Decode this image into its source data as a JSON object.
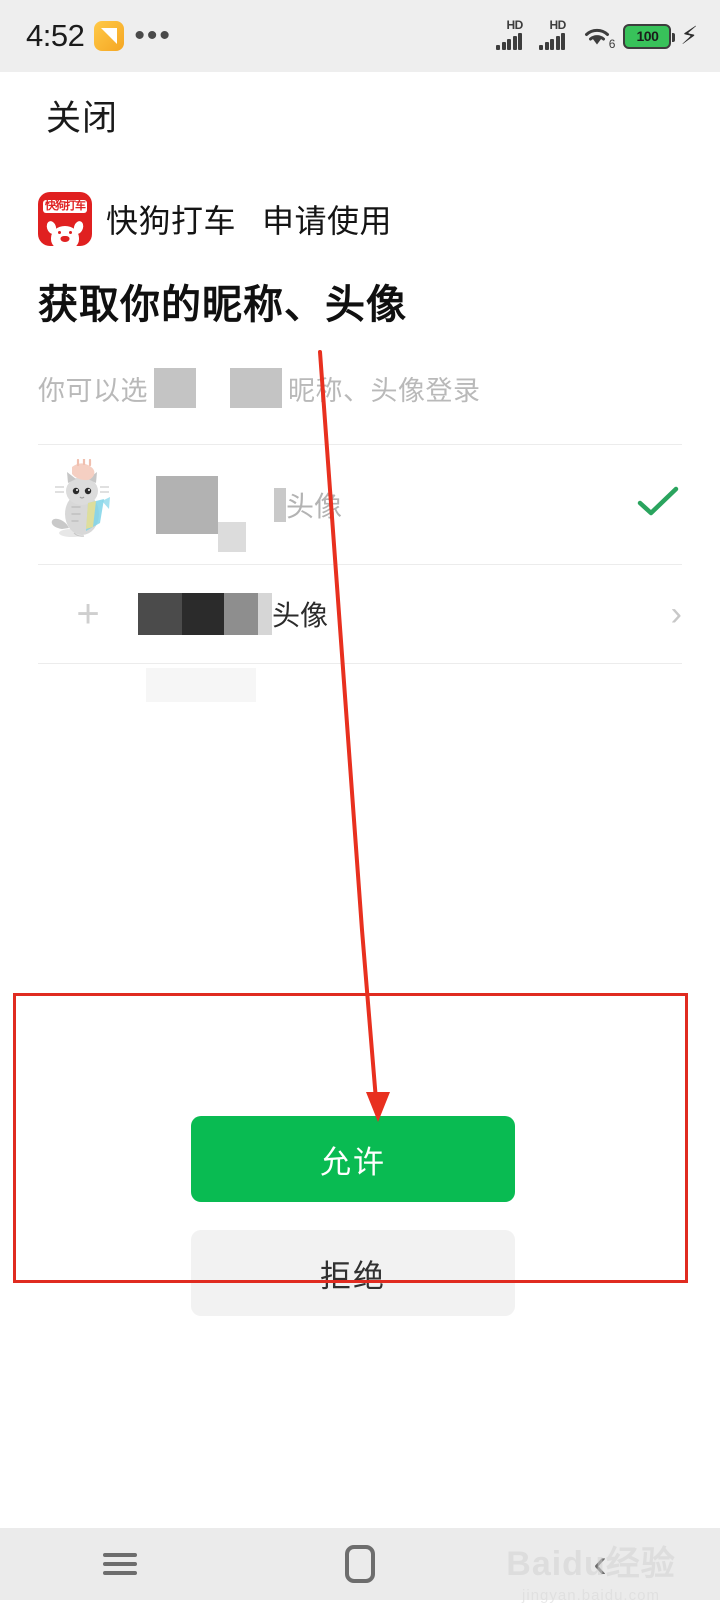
{
  "status_bar": {
    "time": "4:52",
    "overflow_dots": "•••",
    "signal_1_label": "HD",
    "signal_2_label": "HD",
    "wifi_generation": "6",
    "battery_percent": "100",
    "charging_glyph": "⚡"
  },
  "header": {
    "close_label": "关闭"
  },
  "app": {
    "logo_text": "快狗打车",
    "name": "快狗打车",
    "action": "申请使用"
  },
  "permission": {
    "title": "获取你的昵称、头像",
    "subtitle_prefix": "你可以选",
    "subtitle_suffix": "昵称、头像登录"
  },
  "rows": [
    {
      "id": "current-avatar-row",
      "avatar": "cat-avatar",
      "label_suffix": "头像",
      "selected": true,
      "trailing": "check-icon"
    },
    {
      "id": "other-avatar-row",
      "leading": "plus-icon",
      "label_suffix": "头像",
      "selected": false,
      "trailing": "chevron-right-icon"
    }
  ],
  "actions": {
    "allow_label": "允许",
    "refuse_label": "拒绝"
  },
  "navbar": {
    "menu_icon": "menu-icon",
    "home_icon": "home-icon",
    "back_icon": "back-icon"
  },
  "watermark": {
    "main": "Baidu经验",
    "sub": "jingyan.baidu.com"
  },
  "colors": {
    "allow_green": "#09bb52",
    "annotation_red": "#e02b20",
    "brand_red": "#e02020",
    "battery_green": "#38c25a"
  }
}
